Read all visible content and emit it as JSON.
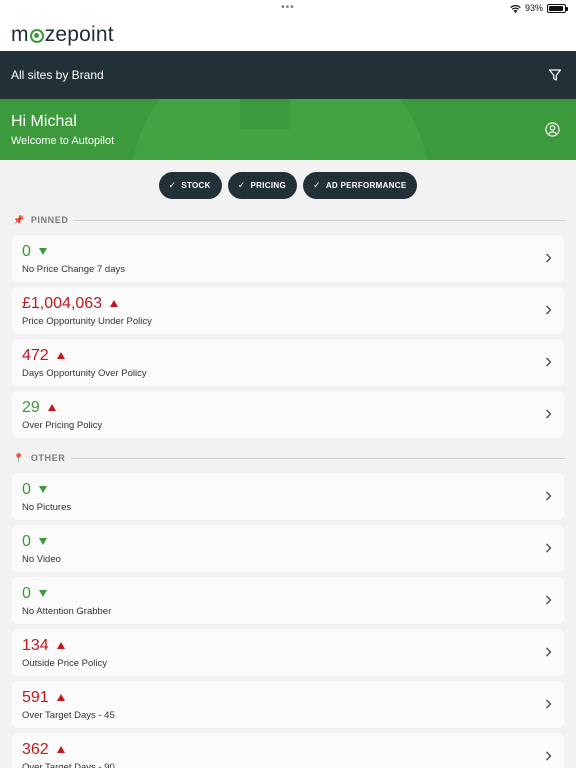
{
  "status": {
    "dots": "•••",
    "battery_text": "93%",
    "battery_level": 0.93
  },
  "logo": {
    "pre": "m",
    "post": "zepoint"
  },
  "nav": {
    "title": "All sites by Brand"
  },
  "hero": {
    "greeting": "Hi Michal",
    "subtitle": "Welcome to Autopilot"
  },
  "chips": [
    {
      "label": "STOCK"
    },
    {
      "label": "PRICING"
    },
    {
      "label": "AD PERFORMANCE"
    }
  ],
  "sections": {
    "pinned": {
      "title": "PINNED",
      "items": [
        {
          "value": "0",
          "label": "No Price Change 7 days",
          "trend": "down",
          "status": "good"
        },
        {
          "value": "£1,004,063",
          "label": "Price Opportunity Under Policy",
          "trend": "up",
          "status": "bad"
        },
        {
          "value": "472",
          "label": "Days Opportunity Over Policy",
          "trend": "up",
          "status": "bad"
        },
        {
          "value": "29",
          "label": "Over Pricing Policy",
          "trend": "up",
          "status": "good"
        }
      ]
    },
    "other": {
      "title": "OTHER",
      "items": [
        {
          "value": "0",
          "label": "No Pictures",
          "trend": "down",
          "status": "good"
        },
        {
          "value": "0",
          "label": "No Video",
          "trend": "down",
          "status": "good"
        },
        {
          "value": "0",
          "label": "No Attention Grabber",
          "trend": "down",
          "status": "good"
        },
        {
          "value": "134",
          "label": "Outside Price Policy",
          "trend": "up",
          "status": "bad"
        },
        {
          "value": "591",
          "label": "Over Target Days - 45",
          "trend": "up",
          "status": "bad"
        },
        {
          "value": "362",
          "label": "Over Target Days - 90",
          "trend": "up",
          "status": "bad"
        }
      ]
    }
  },
  "colors": {
    "brand_green": "#3d9a3c",
    "dark": "#223138",
    "alert_red": "#c0181c"
  },
  "icons": {
    "filter": "filter-icon",
    "user": "user-circle-icon",
    "pin": "pin-icon",
    "chevron": "chevron-right-icon",
    "check": "check-icon"
  }
}
